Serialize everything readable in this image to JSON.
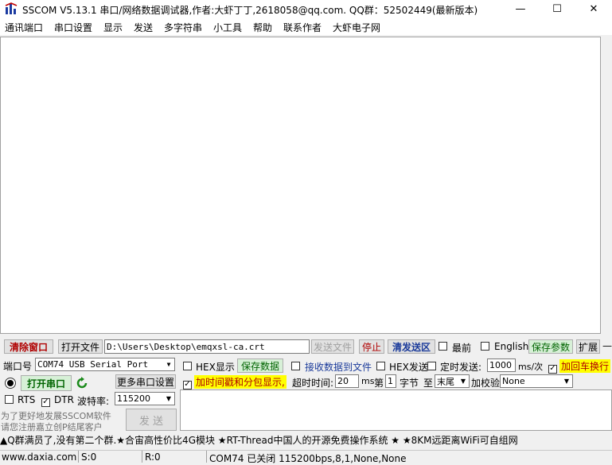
{
  "window": {
    "title": "SSCOM V5.13.1 串口/网络数据调试器,作者:大虾丁丁,2618058@qq.com. QQ群：52502449(最新版本)",
    "minimize": "—",
    "maximize": "☐",
    "close": "✕"
  },
  "menu": [
    "通讯端口",
    "串口设置",
    "显示",
    "发送",
    "多字符串",
    "小工具",
    "帮助",
    "联系作者",
    "大虾电子网"
  ],
  "toolbar": {
    "clear_window": "清除窗口",
    "open_file": "打开文件",
    "file_path": "D:\\Users\\Desktop\\emqxsl-ca.crt",
    "send_file": "发送文件",
    "stop": "停止",
    "clear_send": "清发送区",
    "topmost": "最前",
    "english": "English",
    "save_params": "保存参数",
    "expand": "扩展",
    "dash": "—"
  },
  "port": {
    "port_label": "端口号",
    "port_value": "COM74 USB Serial Port",
    "more_settings": "更多串口设置",
    "open_port": "打开串口",
    "rts": "RTS",
    "dtr": "DTR",
    "baud_label": "波特率:",
    "baud_value": "115200"
  },
  "options": {
    "hex_display": "HEX显示",
    "save_data": "保存数据",
    "recv_to_file": "接收数据到文件",
    "hex_send": "HEX发送",
    "timed_send": "定时发送:",
    "interval_value": "1000",
    "interval_unit": "ms/次",
    "add_crlf": "加回车换行",
    "add_timestamp": "加时间戳和分包显示,",
    "timeout_label": "超时时间:",
    "timeout_value": "20",
    "timeout_unit": "ms",
    "byte_prefix": "第",
    "byte_value": "1",
    "byte_label": "字节",
    "to_label": "至",
    "to_value": "末尾",
    "checksum_label": "加校验",
    "checksum_value": "None"
  },
  "promo": {
    "line1": "为了更好地发展SSCOM软件",
    "line2": "请您注册嘉立创P结尾客户",
    "send_button": "发 送"
  },
  "ticker": "▲Q群满员了,没有第二个群.★合宙高性价比4G模块 ★RT-Thread中国人的开源免费操作系统 ★ ★8KM远距离WiFi可自组网",
  "status": {
    "website": "www.daxia.com",
    "sent": "S:0",
    "received": "R:0",
    "port_state": "COM74 已关闭  115200bps,8,1,None,None"
  },
  "colors": {
    "red_text": "#b00000",
    "green_text": "#006400",
    "blue_text": "#1a3a9a",
    "yellow_highlight": "#ffff00",
    "green_button_bg": "#d7f0d7"
  }
}
